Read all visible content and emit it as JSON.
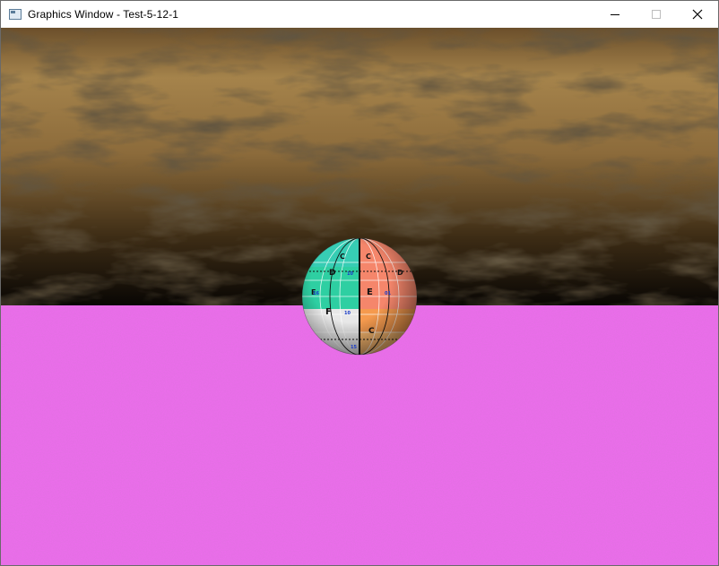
{
  "window": {
    "title": "Graphics Window - Test-5-12-1",
    "controls": [
      "minimize",
      "maximize",
      "close"
    ]
  },
  "scene": {
    "sky_colors": [
      "#6a4f2a",
      "#a6834c",
      "#8a6a3a",
      "#3a2a14",
      "#0a0703"
    ],
    "ground_color": "#ef6bef",
    "sphere_quadrant_colors": {
      "top_left": "#2ecfa2",
      "top_right": "#f5866b",
      "bottom_left": "#e6e6e6",
      "bottom_right": "#f5a458"
    },
    "sphere_labels": [
      "C",
      "C",
      "D",
      "D",
      "E",
      "E",
      "F",
      "C",
      "10",
      "01",
      "10",
      "15",
      "16"
    ]
  }
}
